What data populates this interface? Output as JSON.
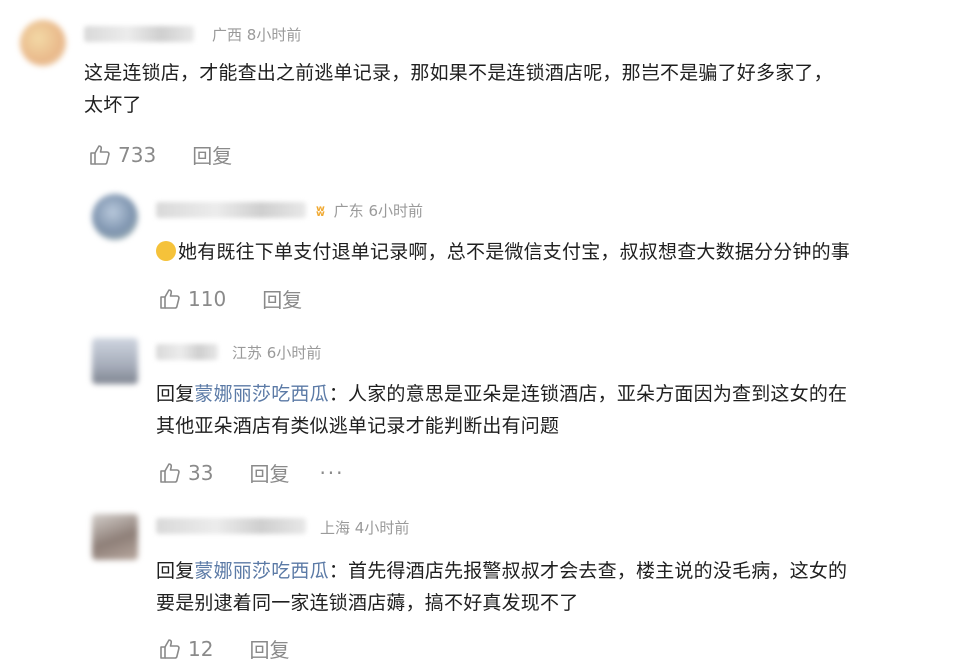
{
  "comments": [
    {
      "location": "广西",
      "time": "8小时前",
      "text_line1": "这是连锁店，才能查出之前逃单记录，那如果不是连锁酒店呢，那岂不是骗了好多家了，",
      "text_line2": "太坏了",
      "likes": "733",
      "reply_label": "回复"
    },
    {
      "location": "广东",
      "time": "6小时前",
      "badge_icon": "vip-badge-icon",
      "text_line1": "她有既往下单支付退单记录啊，总不是微信支付宝，叔叔想查大数据分分钟的事",
      "likes": "110",
      "reply_label": "回复"
    },
    {
      "location": "江苏",
      "time": "6小时前",
      "reply_prefix": "回复",
      "reply_to": "蒙娜丽莎吃西瓜",
      "text_line1": "：人家的意思是亚朵是连锁酒店，亚朵方面因为查到这女的在",
      "text_line2": "其他亚朵酒店有类似逃单记录才能判断出有问题",
      "likes": "33",
      "reply_label": "回复",
      "more_label": "···"
    },
    {
      "location": "上海",
      "time": "4小时前",
      "reply_prefix": "回复",
      "reply_to": "蒙娜丽莎吃西瓜",
      "text_line1": "：首先得酒店先报警叔叔才会去查，楼主说的没毛病，这女的",
      "text_line2": "要是别逮着同一家连锁酒店薅，搞不好真发现不了",
      "likes": "12",
      "reply_label": "回复"
    }
  ],
  "icons": {
    "like": "thumbs-up-icon"
  },
  "colors": {
    "reply_name": "#5b7aa6",
    "meta": "#9a9a9a",
    "action": "#8a8a8a"
  }
}
